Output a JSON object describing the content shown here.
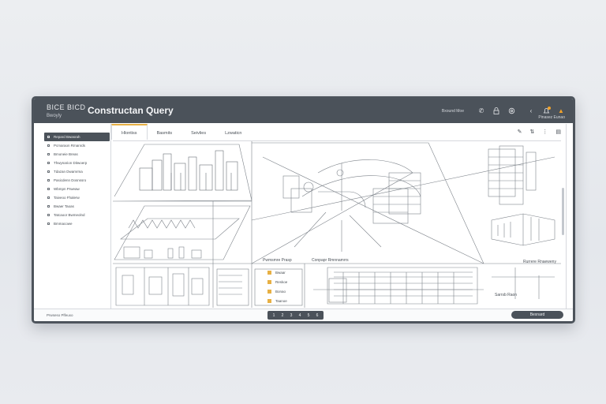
{
  "titlebar": {
    "brand": "BICE BICD",
    "brand_sub": "Bwoyly",
    "title": "Constructan Query",
    "right_label": "Bxound Moe",
    "user_label": "Pinasez Eunao"
  },
  "sidebar": {
    "items": [
      {
        "label": "Repard Bwasrah"
      },
      {
        "label": "Pcmaraon Rmanrds"
      },
      {
        "label": "Bmoneie Breas"
      },
      {
        "label": "Thwynarion Ditwoerp"
      },
      {
        "label": "Tdazan Dwamrma"
      },
      {
        "label": "Pasicdenn Dosnssro"
      },
      {
        "label": "Wbmpn Prweaw"
      },
      {
        "label": "Taiveoo Fhalerw"
      },
      {
        "label": "Bwaer Taoas"
      },
      {
        "label": "Tatcaoor Bwmeolnd"
      },
      {
        "label": "Bmmacowe"
      }
    ]
  },
  "tabs": [
    {
      "label": "Hlontiss"
    },
    {
      "label": "Basmits"
    },
    {
      "label": "Seivlies"
    },
    {
      "label": "Lzwaticn"
    }
  ],
  "canvas": {
    "label_a": "Pwmsmre Prasp",
    "label_b": "Conpapr Rmnnamrrs",
    "label_c": "Rurrere Rnaeweny",
    "label_d": "Sarrsb Raon",
    "panel_rows": [
      {
        "label": "Bwaar"
      },
      {
        "label": "Reskoe"
      },
      {
        "label": "Bonao"
      },
      {
        "label": "Taanoe"
      }
    ]
  },
  "statusbar": {
    "left": "Prwseso Plfeuxo",
    "pager": [
      "1",
      "2",
      "3",
      "4",
      "5",
      "6"
    ],
    "action": "Bexnard"
  },
  "colors": {
    "titlebar": "#4b525a",
    "accent": "#e7b044",
    "line": "#7d838a"
  }
}
